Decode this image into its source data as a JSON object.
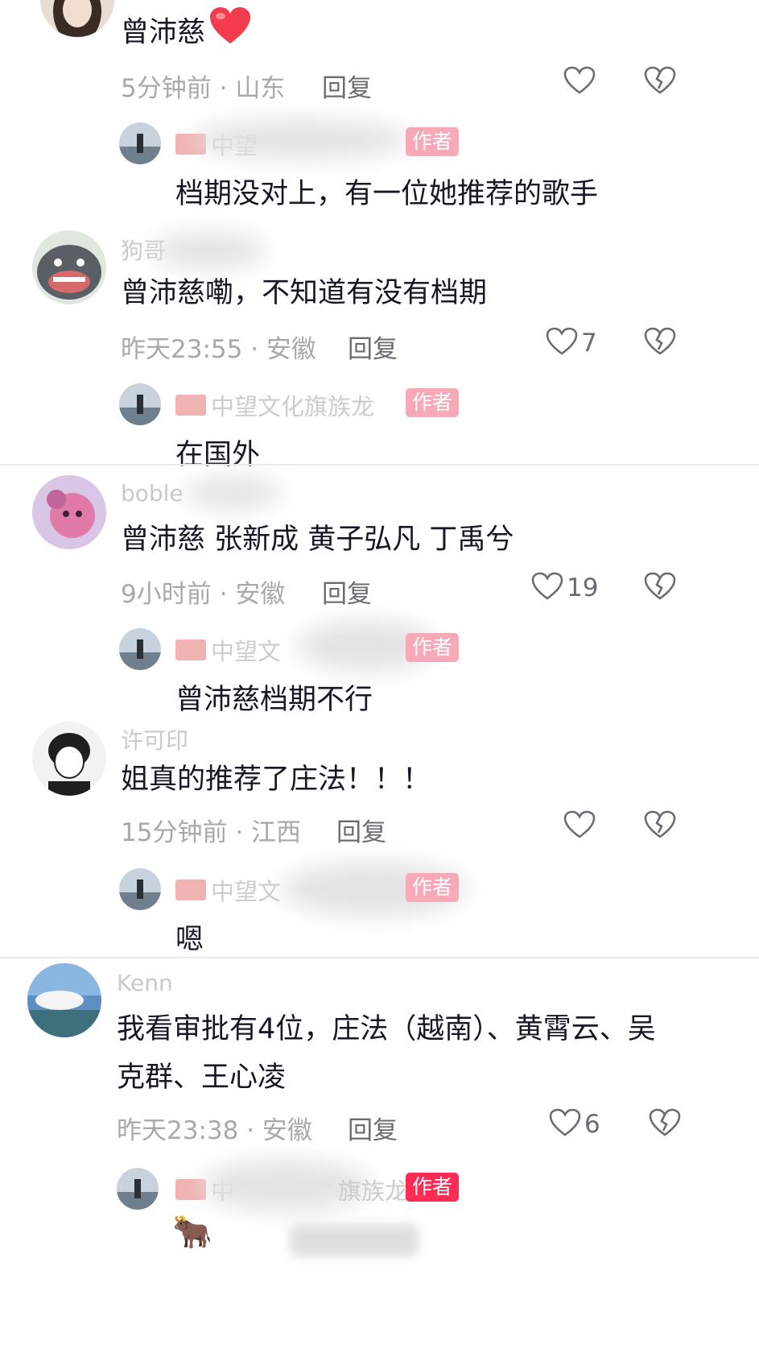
{
  "comments": [
    {
      "username": "",
      "text": "曾沛慈",
      "emoji": "heart",
      "time": "5分钟前",
      "location": "山东",
      "reply_label": "回复",
      "likes": "",
      "reply": {
        "author_name": "中望",
        "badge": "作者",
        "text": "档期没对上，有一位她推荐的歌手"
      }
    },
    {
      "username": "狗哥",
      "text": "曾沛慈嘞，不知道有没有档期",
      "time": "昨天23:55",
      "location": "安徽",
      "reply_label": "回复",
      "likes": "7",
      "reply": {
        "author_name": "中望文化旗族龙",
        "badge": "作者",
        "text": "在国外"
      }
    },
    {
      "username": "boble",
      "text": "曾沛慈 张新成 黄子弘凡 丁禹兮",
      "time": "9小时前",
      "location": "安徽",
      "reply_label": "回复",
      "likes": "19",
      "reply": {
        "author_name": "中望文",
        "badge": "作者",
        "text": "曾沛慈档期不行"
      }
    },
    {
      "username": "许可印",
      "text": "姐真的推荐了庄法！！！",
      "time": "15分钟前",
      "location": "江西",
      "reply_label": "回复",
      "likes": "",
      "reply": {
        "author_name": "中望文",
        "badge": "作者",
        "text": "嗯"
      }
    },
    {
      "username": "Kenn",
      "text_line1": "我看审批有4位，庄法（越南）、黄霄云、吴",
      "text_line2": "克群、王心凌",
      "time": "昨天23:38",
      "location": "安徽",
      "reply_label": "回复",
      "likes": "6",
      "reply": {
        "author_name": "中",
        "author_name_tail": "旗族龙",
        "badge": "作者",
        "text": "🐂"
      }
    }
  ],
  "meta_separator": "·",
  "icons": {
    "like": "heart-outline-icon",
    "dislike": "broken-heart-icon",
    "flag": "china-flag-icon"
  },
  "colors": {
    "badge": "#fe2c55",
    "meta": "#a8a9ad",
    "text": "#161823"
  }
}
